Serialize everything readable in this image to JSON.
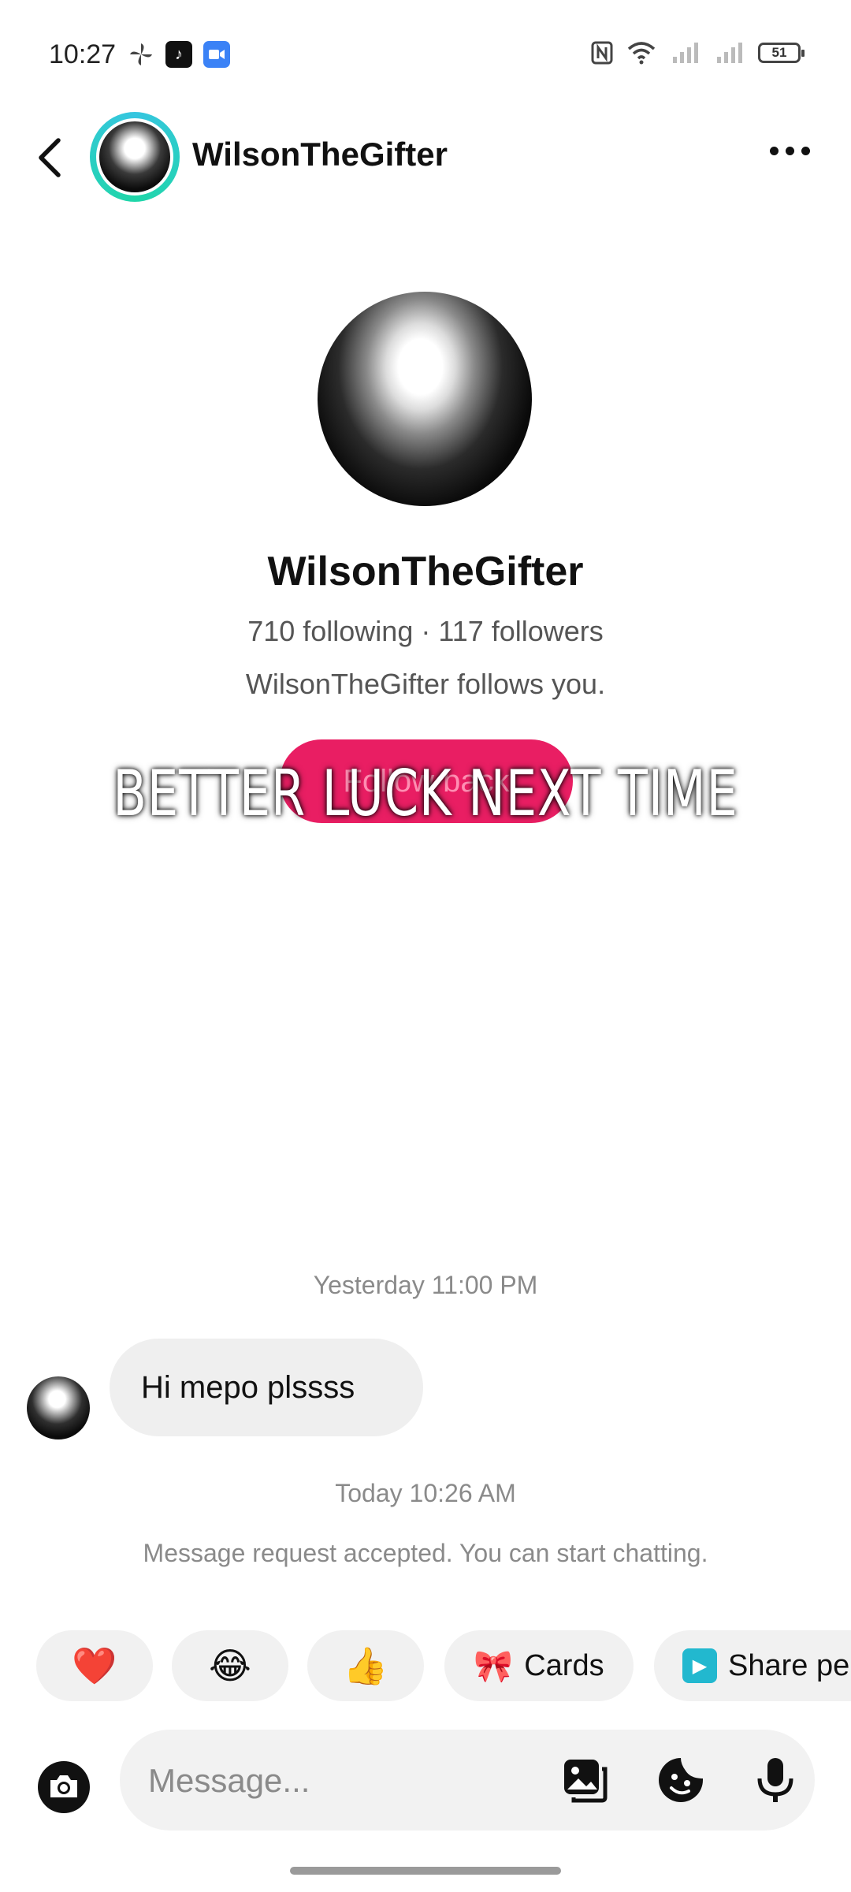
{
  "status_bar": {
    "time": "10:27",
    "battery": "51"
  },
  "header": {
    "username": "WilsonTheGifter"
  },
  "profile": {
    "name": "WilsonTheGifter",
    "stats": "710 following · 117 followers",
    "follows_you": "WilsonTheGifter follows you.",
    "follow_back_label": "Follow back"
  },
  "overlay_caption": "BETTER LUCK NEXT TIME",
  "conversation": {
    "timestamp_1": "Yesterday 11:00 PM",
    "message_1": "Hi mepo plssss",
    "timestamp_2": "Today 10:26 AM",
    "system_message": "Message request accepted. You can start chatting."
  },
  "quick_replies": [
    {
      "icon": "❤️",
      "label": ""
    },
    {
      "icon": "😂",
      "label": ""
    },
    {
      "icon": "👍",
      "label": ""
    },
    {
      "icon": "🎀",
      "label": "Cards"
    },
    {
      "icon": "▶",
      "label": "Share pe"
    }
  ],
  "composer": {
    "placeholder": "Message..."
  },
  "colors": {
    "accent": "#e91e63",
    "ring": "#36c6e0"
  }
}
